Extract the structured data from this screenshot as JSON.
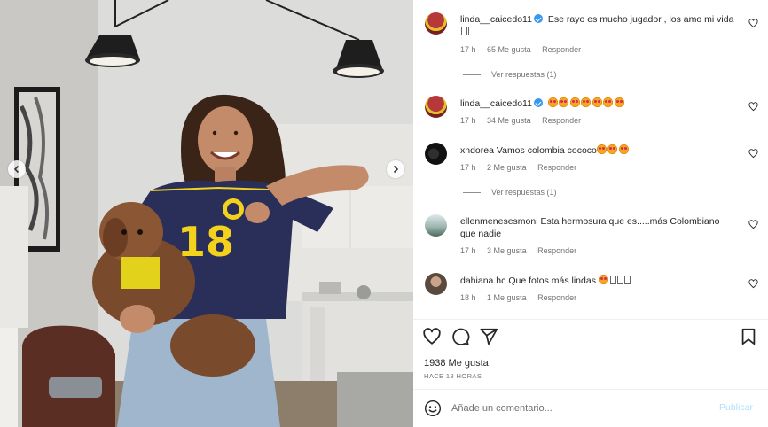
{
  "comments": [
    {
      "username": "linda__caicedo11",
      "verified": true,
      "text": "Ese rayo es mucho jugador , los amo mi vida",
      "text_boxes": 2,
      "time": "17 h",
      "likes": "65 Me gusta",
      "reply": "Responder",
      "view_replies": "Ver respuestas (1)"
    },
    {
      "username": "linda__caicedo11",
      "verified": true,
      "emojis": 7,
      "time": "17 h",
      "likes": "34 Me gusta",
      "reply": "Responder"
    },
    {
      "username": "xndorea",
      "text": "Vamos colombia cococo",
      "emojis": 3,
      "time": "17 h",
      "likes": "2 Me gusta",
      "reply": "Responder",
      "view_replies": "Ver respuestas (1)"
    },
    {
      "username": "ellenmenesesmoni",
      "text": "Esta hermosura que es.....más Colombiano que nadie",
      "time": "17 h",
      "likes": "3 Me gusta",
      "reply": "Responder"
    },
    {
      "username": "dahiana.hc",
      "text": "Que fotos más lindas",
      "emojis": 1,
      "text_boxes": 3,
      "time": "18 h",
      "likes": "1 Me gusta",
      "reply": "Responder"
    }
  ],
  "post": {
    "likes": "1938 Me gusta",
    "time": "HACE 18 HORAS"
  },
  "composer": {
    "placeholder": "Añade un comentario...",
    "publish": "Publicar"
  },
  "photo": {
    "jersey_number": "18"
  },
  "colors": {
    "verified": "#3897f0",
    "meta": "#737373",
    "publish_disabled": "#b2dffc",
    "jersey": "#2a2f5a",
    "jersey_number": "#f2d21c"
  }
}
